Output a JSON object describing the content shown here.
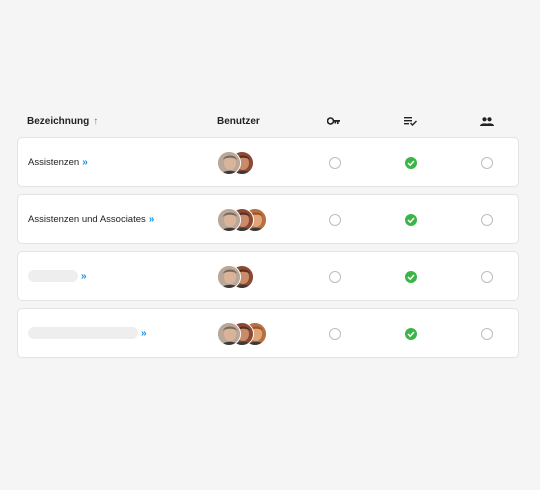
{
  "header": {
    "name_label": "Bezeichnung",
    "sort_arrow": "↑",
    "users_label": "Benutzer"
  },
  "more_glyph": "»",
  "rows": [
    {
      "name": "Assistenzen",
      "avatar_count": 2,
      "permission": false,
      "active": true,
      "group": false
    },
    {
      "name": "Assistenzen und Associates",
      "avatar_count": 3,
      "permission": false,
      "active": true,
      "group": false
    },
    {
      "name": "",
      "avatar_count": 2,
      "permission": false,
      "active": true,
      "group": false
    },
    {
      "name": "",
      "avatar_count": 3,
      "permission": false,
      "active": true,
      "group": false
    }
  ],
  "colors": {
    "accent": "#1a8fe0",
    "check": "#3cb548"
  }
}
